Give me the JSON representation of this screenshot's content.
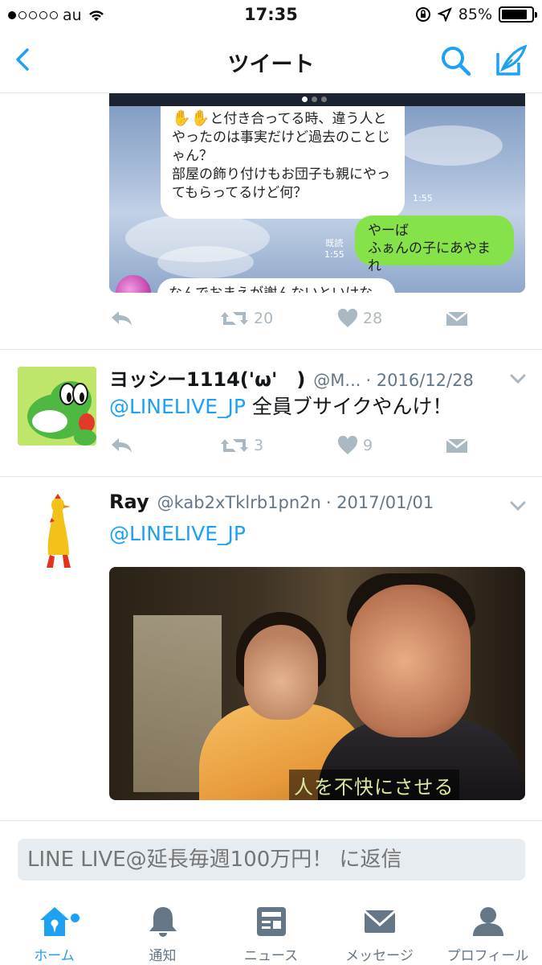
{
  "status_bar": {
    "carrier": "au",
    "time": "17:35",
    "battery": "85%",
    "signal_bars": 1,
    "battery_level": 0.85
  },
  "nav": {
    "title": "ツイート",
    "back_icon": "chevron-left-icon",
    "search_icon": "search-icon",
    "compose_icon": "compose-icon",
    "accent_color": "#1da1f2"
  },
  "tweet1": {
    "media": {
      "page_index": 1,
      "page_count": 3,
      "chat_white_text": [
        "と付き合ってる時、違う人と",
        "やったのは事実だけど過去のことじ",
        "ゃん？",
        "部屋の飾り付けもお団子も親にやっ",
        "てもらってるけど何？"
      ],
      "chat_time_1": "1:55",
      "read_label": "既読",
      "read_time": "1:55",
      "chat_green_text": [
        "やーば",
        "ふぁんの子にあやまれ"
      ],
      "chat_partial_text": "なんでおまえが謝んないといけない"
    },
    "retweets": "20",
    "likes": "28"
  },
  "tweet2": {
    "name": "ヨッシー1114('ω'　)",
    "handle": "@M...",
    "date": "· 2016/12/28",
    "mention": "@LINELIVE_JP",
    "text": " 全員ブサイクやんけ！",
    "retweets": "3",
    "likes": "9"
  },
  "tweet3": {
    "name": "Ray",
    "handle": "@kab2xTklrb1pn2n",
    "date": "· 2017/01/01",
    "mention": "@LINELIVE_JP",
    "media_subtitle": "人を不快にさせる"
  },
  "reply": {
    "placeholder": "LINE LIVE@延長毎週100万円！ に返信"
  },
  "tabbar": {
    "items": [
      {
        "label": "ホーム",
        "icon": "home-icon",
        "active": true
      },
      {
        "label": "通知",
        "icon": "bell-icon",
        "active": false
      },
      {
        "label": "ニュース",
        "icon": "news-icon",
        "active": false
      },
      {
        "label": "メッセージ",
        "icon": "envelope-icon",
        "active": false
      },
      {
        "label": "プロフィール",
        "icon": "person-icon",
        "active": false
      }
    ]
  }
}
